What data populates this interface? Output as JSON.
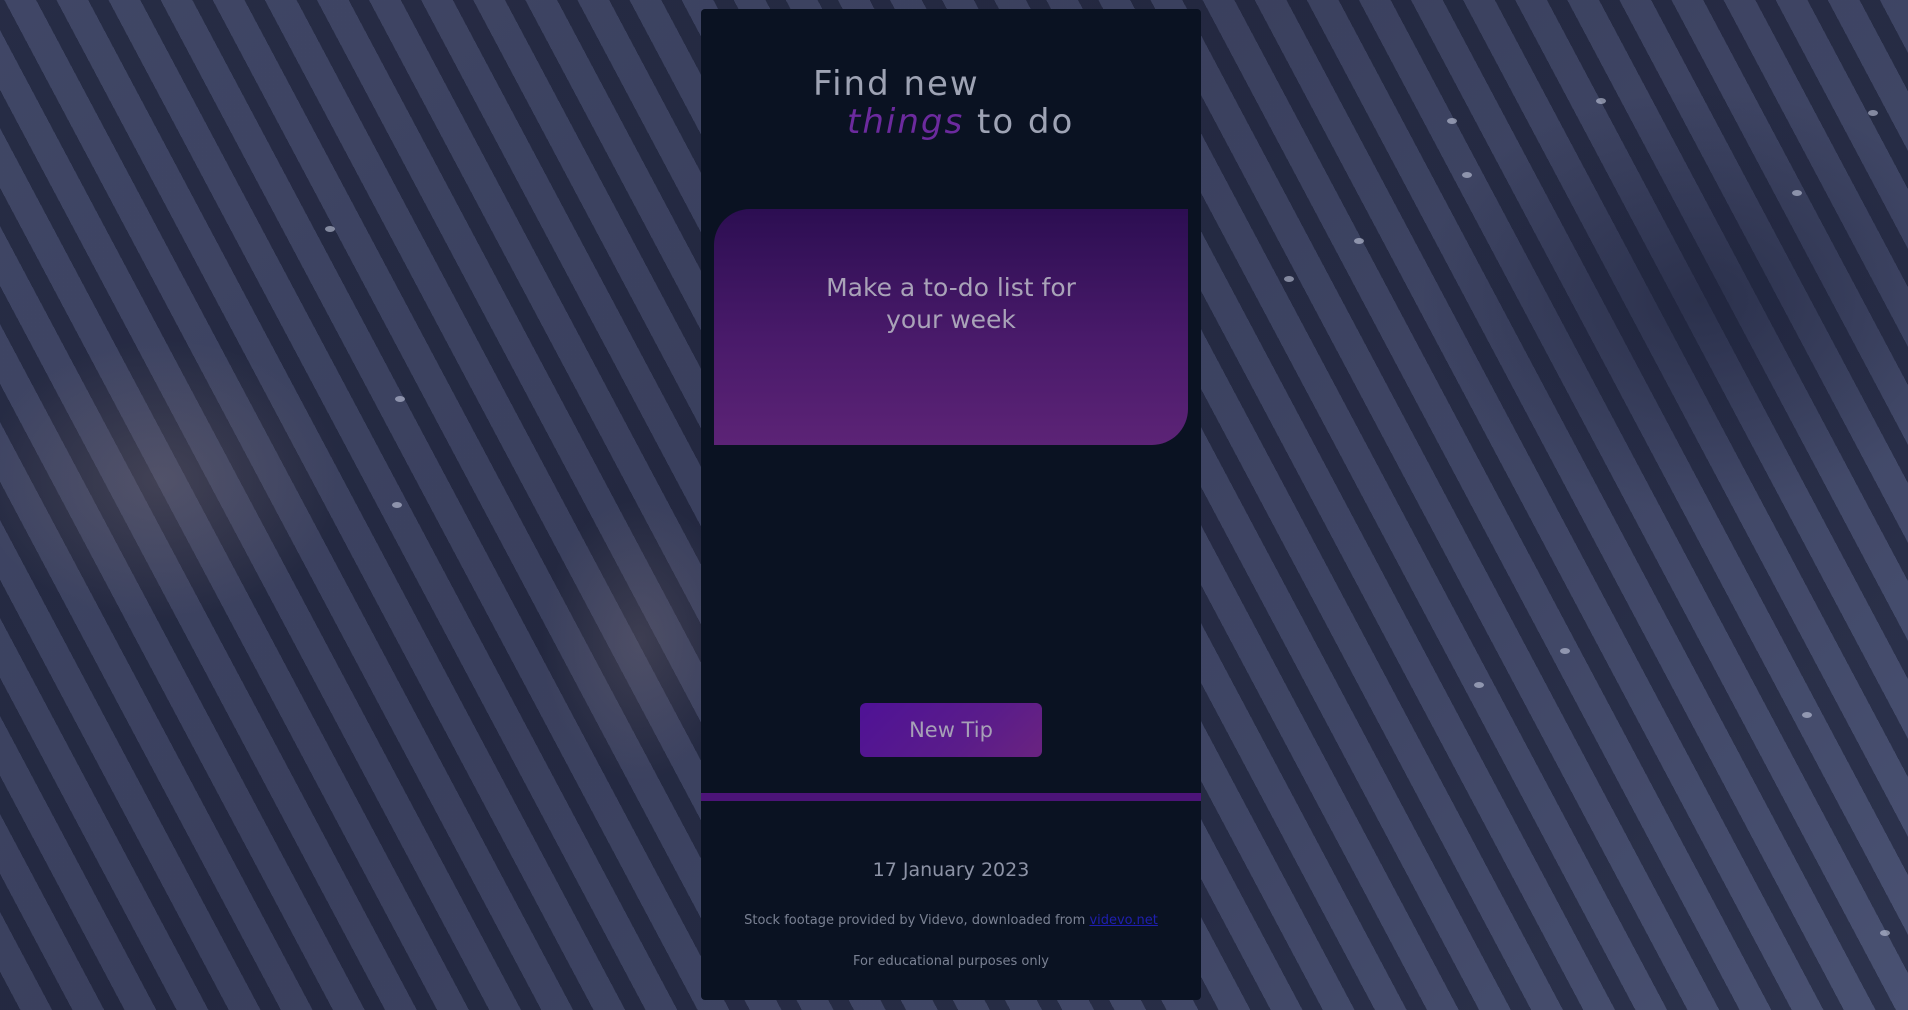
{
  "headline": {
    "line1": "Find new",
    "accent": "things",
    "rest": "to do"
  },
  "tip": {
    "text": "Make a to-do list for your week"
  },
  "new_tip_button": "New Tip",
  "footer": {
    "date": "17 January 2023",
    "credit_prefix": "Stock footage provided by Videvo, downloaded from",
    "credit_link": "videvo.net",
    "disclaimer": "For educational purposes only"
  },
  "colors": {
    "accent": "#6c2a9e",
    "card_background": "#0a1222",
    "divider": "#4c1478"
  }
}
